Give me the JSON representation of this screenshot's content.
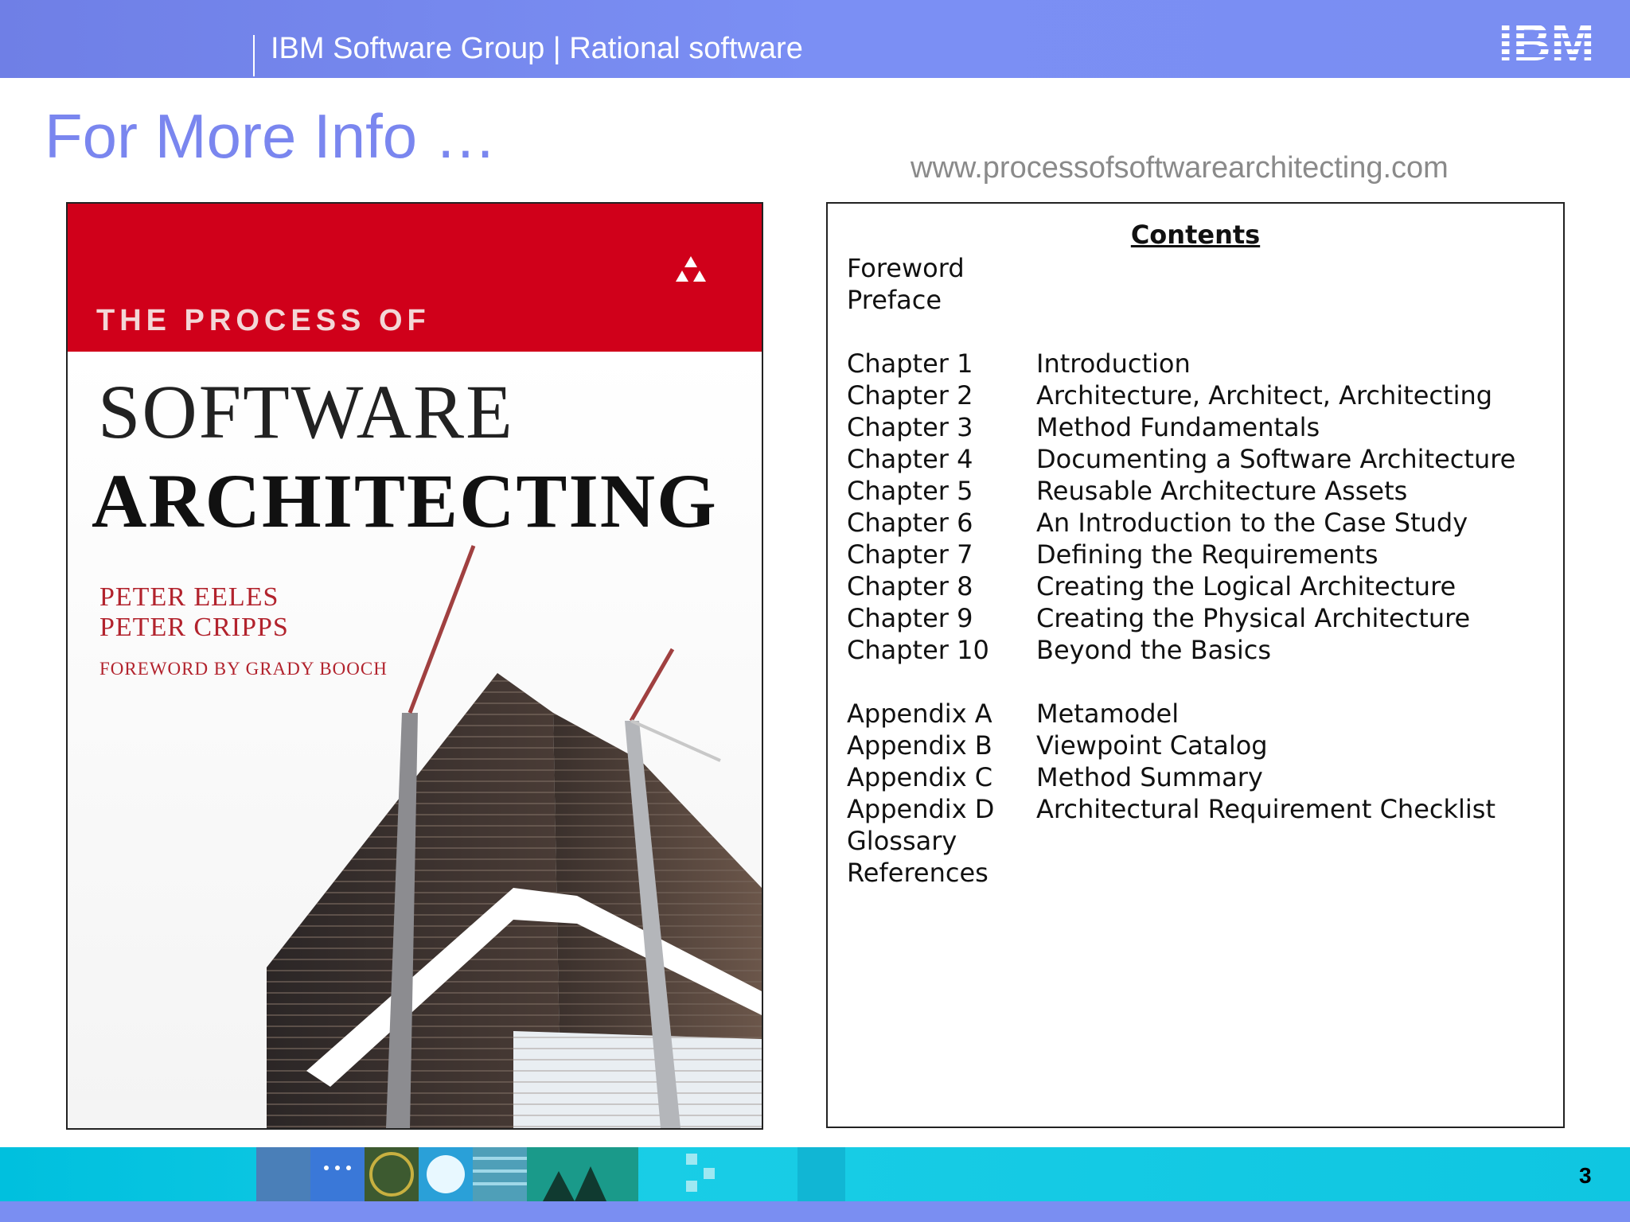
{
  "header": {
    "group_title": "IBM Software Group | Rational software",
    "logo_text": "IBM"
  },
  "slide": {
    "title": "For More Info …",
    "url": "www.processofsoftwarearchitecting.com",
    "page_number": "3"
  },
  "book_cover": {
    "series": "THE PROCESS OF",
    "title_line1": "SOFTWARE",
    "title_line2": "ARCHITECTING",
    "authors": [
      "PETER EELES",
      "PETER CRIPPS"
    ],
    "foreword": "FOREWORD BY GRADY BOOCH",
    "band_color": "#d0001a"
  },
  "contents": {
    "heading": "Contents",
    "front_matter": [
      "Foreword",
      "Preface"
    ],
    "chapters": [
      {
        "label": "Chapter 1",
        "title": "Introduction"
      },
      {
        "label": "Chapter 2",
        "title": "Architecture, Architect, Architecting"
      },
      {
        "label": "Chapter 3",
        "title": "Method Fundamentals"
      },
      {
        "label": "Chapter 4",
        "title": "Documenting a Software Architecture"
      },
      {
        "label": "Chapter 5",
        "title": "Reusable Architecture Assets"
      },
      {
        "label": "Chapter 6",
        "title": "An Introduction to the Case Study"
      },
      {
        "label": "Chapter 7",
        "title": "Defining the Requirements"
      },
      {
        "label": "Chapter 8",
        "title": "Creating the Logical Architecture"
      },
      {
        "label": "Chapter 9",
        "title": "Creating the Physical Architecture"
      },
      {
        "label": "Chapter 10",
        "title": "Beyond the Basics"
      }
    ],
    "appendices": [
      {
        "label": "Appendix A",
        "title": "Metamodel"
      },
      {
        "label": "Appendix B",
        "title": "Viewpoint Catalog"
      },
      {
        "label": "Appendix C",
        "title": "Method Summary"
      },
      {
        "label": "Appendix D",
        "title": "Architectural Requirement Checklist"
      }
    ],
    "back_matter": [
      "Glossary",
      "References"
    ]
  }
}
